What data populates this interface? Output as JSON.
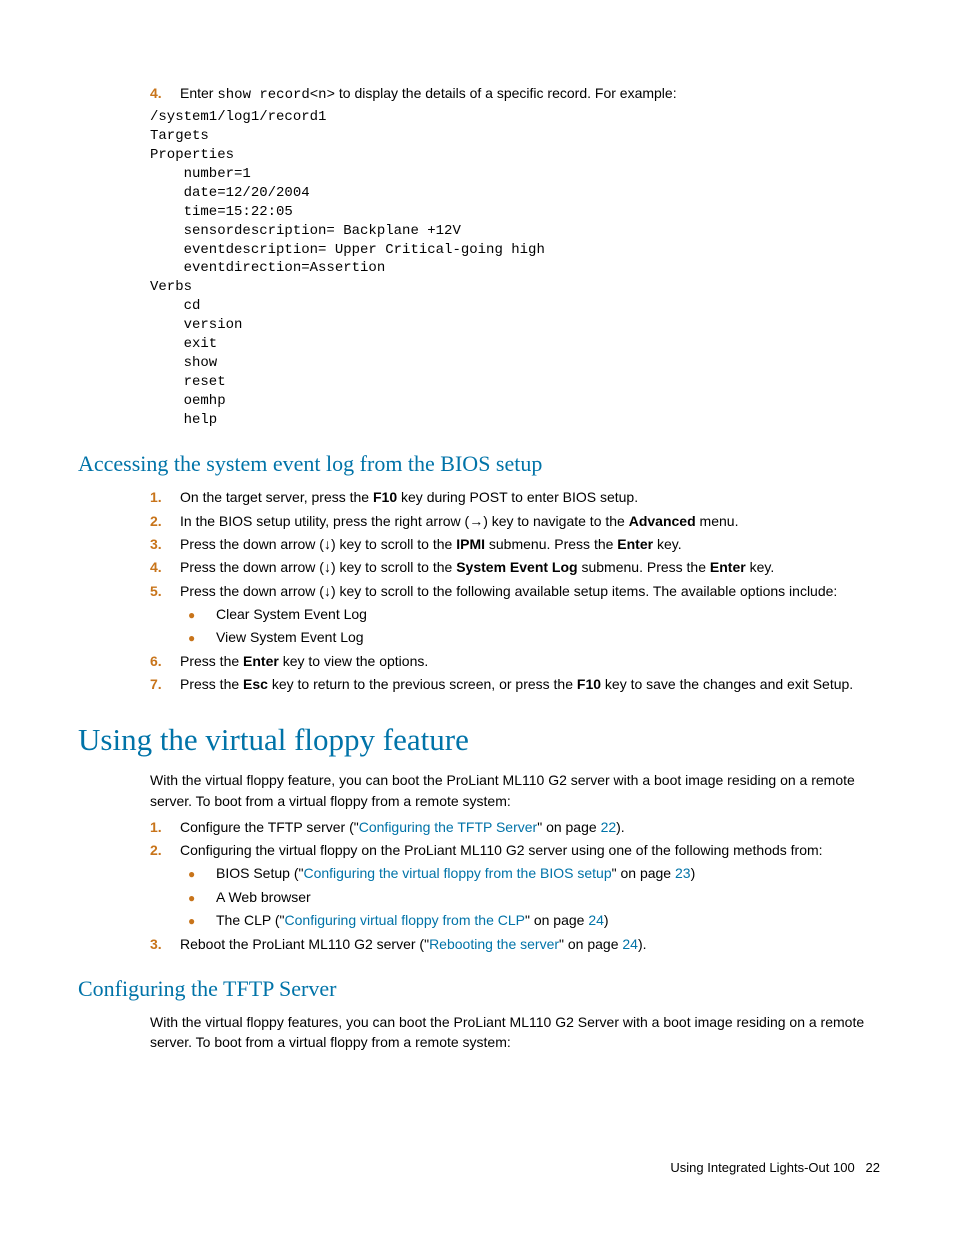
{
  "topStep": {
    "num": "4.",
    "prefix": "Enter ",
    "code": "show record<n>",
    "suffix": " to display the details of a specific record. For example:"
  },
  "codeblock": "/system1/log1/record1\nTargets\nProperties\n    number=1\n    date=12/20/2004\n    time=15:22:05\n    sensordescription= Backplane +12V\n    eventdescription= Upper Critical-going high\n    eventdirection=Assertion\nVerbs\n    cd\n    version\n    exit\n    show\n    reset\n    oemhp\n    help",
  "section1": {
    "title": "Accessing the system event log from the BIOS setup",
    "steps": [
      {
        "num": "1.",
        "parts": [
          {
            "t": "On the target server, press the "
          },
          {
            "t": "F10",
            "b": true
          },
          {
            "t": " key during POST to enter BIOS setup."
          }
        ]
      },
      {
        "num": "2.",
        "parts": [
          {
            "t": "In the BIOS setup utility, press the right arrow (→) key to navigate to the "
          },
          {
            "t": "Advanced",
            "b": true
          },
          {
            "t": " menu."
          }
        ]
      },
      {
        "num": "3.",
        "parts": [
          {
            "t": "Press the down arrow (↓) key to scroll to the "
          },
          {
            "t": "IPMI",
            "b": true
          },
          {
            "t": " submenu. Press the "
          },
          {
            "t": "Enter",
            "b": true
          },
          {
            "t": " key."
          }
        ]
      },
      {
        "num": "4.",
        "parts": [
          {
            "t": "Press the down arrow (↓) key to scroll to the "
          },
          {
            "t": "System Event Log",
            "b": true
          },
          {
            "t": " submenu. Press the "
          },
          {
            "t": "Enter",
            "b": true
          },
          {
            "t": " key."
          }
        ]
      },
      {
        "num": "5.",
        "parts": [
          {
            "t": "Press the down arrow (↓) key to scroll to the following available setup items. The available options include:"
          }
        ],
        "bullets": [
          "Clear System Event Log",
          "View System Event Log"
        ]
      },
      {
        "num": "6.",
        "parts": [
          {
            "t": "Press the "
          },
          {
            "t": "Enter",
            "b": true
          },
          {
            "t": " key to view the options."
          }
        ]
      },
      {
        "num": "7.",
        "parts": [
          {
            "t": "Press the "
          },
          {
            "t": "Esc",
            "b": true
          },
          {
            "t": " key to return to the previous screen, or press the "
          },
          {
            "t": "F10",
            "b": true
          },
          {
            "t": " key to save the changes and exit Setup."
          }
        ]
      }
    ]
  },
  "section2": {
    "title": "Using the virtual floppy feature",
    "intro": "With the virtual floppy feature, you can boot the ProLiant ML110 G2 server with a boot image residing on a remote server. To boot from a virtual floppy from a remote system:",
    "steps": [
      {
        "num": "1.",
        "parts": [
          {
            "t": "Configure the TFTP server (\""
          },
          {
            "t": "Configuring the TFTP Server",
            "link": true
          },
          {
            "t": "\" on page "
          },
          {
            "t": "22",
            "link": true
          },
          {
            "t": ")."
          }
        ]
      },
      {
        "num": "2.",
        "parts": [
          {
            "t": "Configuring the virtual floppy on the ProLiant ML110 G2 server using one of the following methods from:"
          }
        ],
        "bullets2": [
          [
            {
              "t": "BIOS Setup (\""
            },
            {
              "t": "Configuring the virtual floppy from the BIOS setup",
              "link": true
            },
            {
              "t": "\" on page "
            },
            {
              "t": "23",
              "link": true
            },
            {
              "t": ")"
            }
          ],
          [
            {
              "t": "A Web browser"
            }
          ],
          [
            {
              "t": "The CLP (\""
            },
            {
              "t": "Configuring virtual floppy from the CLP",
              "link": true
            },
            {
              "t": "\" on page "
            },
            {
              "t": "24",
              "link": true
            },
            {
              "t": ")"
            }
          ]
        ]
      },
      {
        "num": "3.",
        "parts": [
          {
            "t": "Reboot the ProLiant ML110 G2 server (\""
          },
          {
            "t": "Rebooting the server",
            "link": true
          },
          {
            "t": "\" on page "
          },
          {
            "t": "24",
            "link": true
          },
          {
            "t": ")."
          }
        ]
      }
    ]
  },
  "section3": {
    "title": "Configuring the TFTP Server",
    "intro": "With the virtual floppy features, you can boot the ProLiant ML110 G2 Server with a boot image residing on a remote server. To boot from a virtual floppy from a remote system:"
  },
  "footer": {
    "text": "Using Integrated Lights-Out 100",
    "page": "22"
  }
}
